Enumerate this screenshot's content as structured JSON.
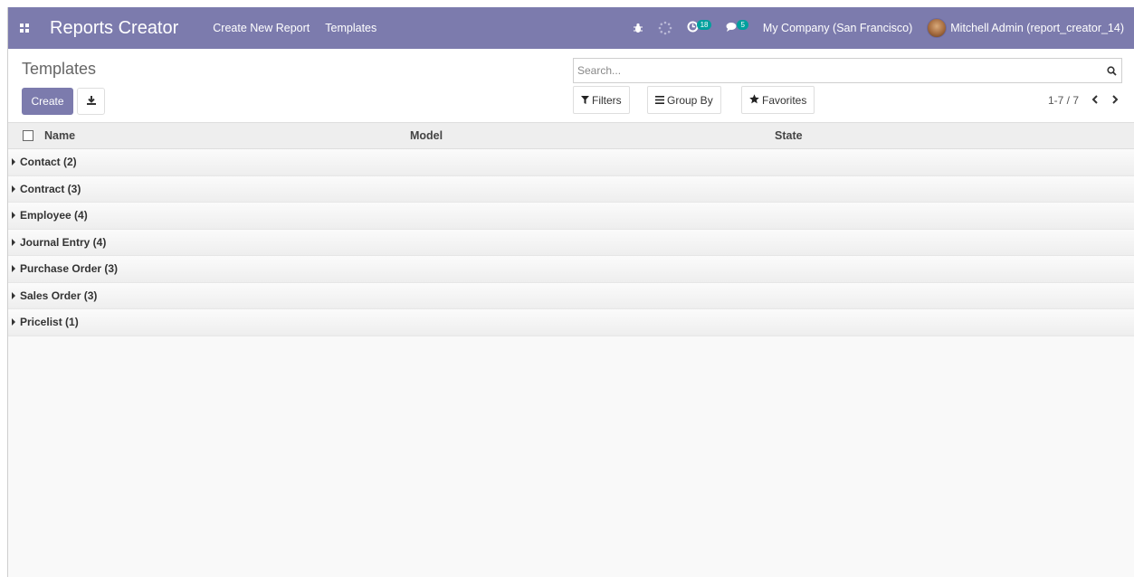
{
  "navbar": {
    "app_title": "Reports Creator",
    "links": [
      "Create New Report",
      "Templates"
    ],
    "activity_count": "18",
    "message_count": "5",
    "company": "My Company (San Francisco)",
    "user": "Mitchell Admin (report_creator_14)"
  },
  "control_panel": {
    "breadcrumb": "Templates",
    "create_label": "Create",
    "search_placeholder": "Search...",
    "filters_label": "Filters",
    "groupby_label": "Group By",
    "favorites_label": "Favorites",
    "pager": "1-7 / 7"
  },
  "list": {
    "columns": [
      "Name",
      "Model",
      "State"
    ],
    "groups": [
      "Contact (2)",
      "Contract (3)",
      "Employee (4)",
      "Journal Entry (4)",
      "Purchase Order (3)",
      "Sales Order (3)",
      "Pricelist (1)"
    ]
  },
  "colors": {
    "brand": "#7c7bad",
    "badge": "#00a09d"
  }
}
